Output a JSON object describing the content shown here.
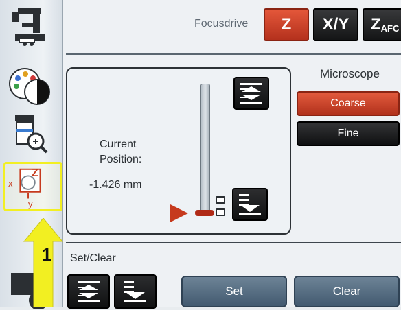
{
  "header": {
    "section_label": "Focusdrive",
    "tabs": [
      {
        "label": "Z",
        "active": true
      },
      {
        "label": "X/Y",
        "active": false
      },
      {
        "label": "Z",
        "sub": "AFC",
        "active": false
      }
    ]
  },
  "rail": {
    "items": [
      "microscope-icon",
      "palette-contrast-icon",
      "magnifier-objective-icon",
      "xyz-stage-icon",
      "settings-icon"
    ],
    "selected_axis_labels": {
      "x": "x",
      "y": "y",
      "z": "Z"
    }
  },
  "annotation": {
    "number": "1",
    "color": "#f2ef22"
  },
  "panel": {
    "current_label_line1": "Current",
    "current_label_line2": "Position:",
    "current_value": "-1.426 mm"
  },
  "microscope": {
    "label": "Microscope",
    "coarse_label": "Coarse",
    "fine_label": "Fine"
  },
  "setclear": {
    "label": "Set/Clear",
    "set_label": "Set",
    "clear_label": "Clear"
  },
  "colors": {
    "accent": "#c63a1d",
    "dark": "#141516",
    "set_blue": "#5a7086"
  }
}
